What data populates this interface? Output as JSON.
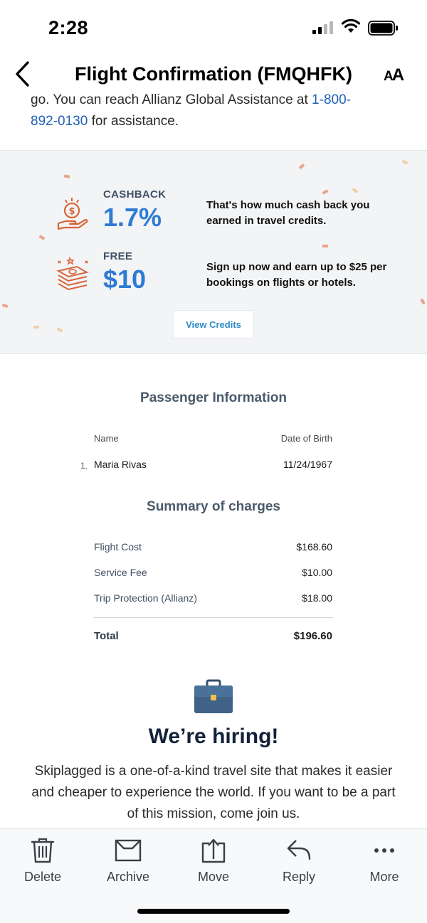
{
  "status_bar": {
    "time": "2:28"
  },
  "nav": {
    "title": "Flight Confirmation (FMQHFK)",
    "text_size_small": "A",
    "text_size_large": "A"
  },
  "intro": {
    "text_1": "go. You can reach Allianz Global Assistance at ",
    "phone_1": "1-800-",
    "phone_2": "892-0130",
    "text_2": " for assistance."
  },
  "credits": {
    "cashback_label": "CASHBACK",
    "cashback_value": "1.7%",
    "cashback_desc": "That's how much cash back you earned in travel credits.",
    "free_label": "FREE",
    "free_value": "$10",
    "free_desc": "Sign up now and earn up to $25 per bookings on flights or hotels.",
    "button": "View Credits",
    "accent_color": "#2e7bd4",
    "icon_color": "#d9643a"
  },
  "passenger": {
    "title": "Passenger Information",
    "col_name": "Name",
    "col_dob": "Date of Birth",
    "rows": [
      {
        "num": "1.",
        "name": "Maria Rivas",
        "dob": "11/24/1967"
      }
    ]
  },
  "charges": {
    "title": "Summary of charges",
    "items": [
      {
        "label": "Flight Cost",
        "value": "$168.60"
      },
      {
        "label": "Service Fee",
        "value": "$10.00"
      },
      {
        "label": "Trip Protection (Allianz)",
        "value": "$18.00"
      }
    ],
    "total_label": "Total",
    "total_value": "$196.60"
  },
  "hiring": {
    "title": "We’re hiring!",
    "text": "Skiplagged is a one-of-a-kind travel site that makes it easier and cheaper to experience the world. If you want to be a part of this mission, come join us."
  },
  "toolbar": {
    "items": [
      {
        "label": "Delete",
        "icon": "trash-icon"
      },
      {
        "label": "Archive",
        "icon": "archive-icon"
      },
      {
        "label": "Move",
        "icon": "move-icon"
      },
      {
        "label": "Reply",
        "icon": "reply-icon"
      },
      {
        "label": "More",
        "icon": "more-icon"
      }
    ]
  }
}
